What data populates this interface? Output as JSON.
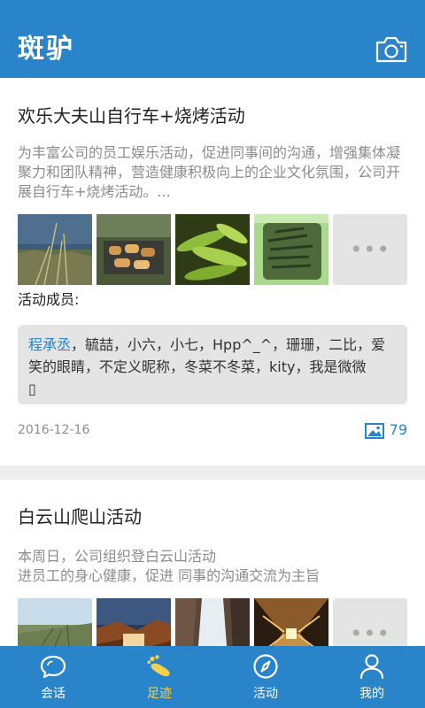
{
  "header": {
    "app_name": "斑驴",
    "camera_icon": "camera-icon",
    "color": "#2a84c9"
  },
  "feed": [
    {
      "title": "欢乐大夫山自行车+烧烤活动",
      "description": "为丰富公司的员工娱乐活动，促进同事间的沟通，增强集体凝聚力和团队精神，营造健康积极向上的企业文化氛围，公司开展自行车+烧烤活动。...",
      "photos": [
        "lake-shore-photo",
        "barbecue-grill-photo",
        "green-peppers-photo",
        "fish-bag-photo"
      ],
      "more_icon": "more-dots-icon",
      "members_label": "活动成员:",
      "members_highlight": "程承丞",
      "members_rest": "，毓喆，小六，小七，Hpp^_^，珊珊，二比，爱笑的眼睛，不定义昵称，冬菜不冬菜，kity，我是微微",
      "members_end_glyph": "▯",
      "date": "2016-12-16",
      "photo_count": "79"
    },
    {
      "title": "白云山爬山活动",
      "description_line1": "本周日，公司组织登白云山活动",
      "description_line2": "进员工的身心健康，促进 同事的沟通交流为主旨",
      "photos": [
        "field-sky-photo",
        "canyon-sunset-photo",
        "waterfall-photo",
        "tunnel-light-photo"
      ],
      "more_icon": "more-dots-icon"
    }
  ],
  "tabs": [
    {
      "label": "会话",
      "icon": "chat-bubble-icon",
      "active": false
    },
    {
      "label": "足迹",
      "icon": "footprint-icon",
      "active": true
    },
    {
      "label": "活动",
      "icon": "compass-icon",
      "active": false
    },
    {
      "label": "我的",
      "icon": "person-icon",
      "active": false
    }
  ],
  "colors": {
    "primary": "#2a84c9",
    "active_tab": "#f6d04d",
    "muted_text": "#8c8c8c",
    "members_bg": "#e4e4e4"
  }
}
